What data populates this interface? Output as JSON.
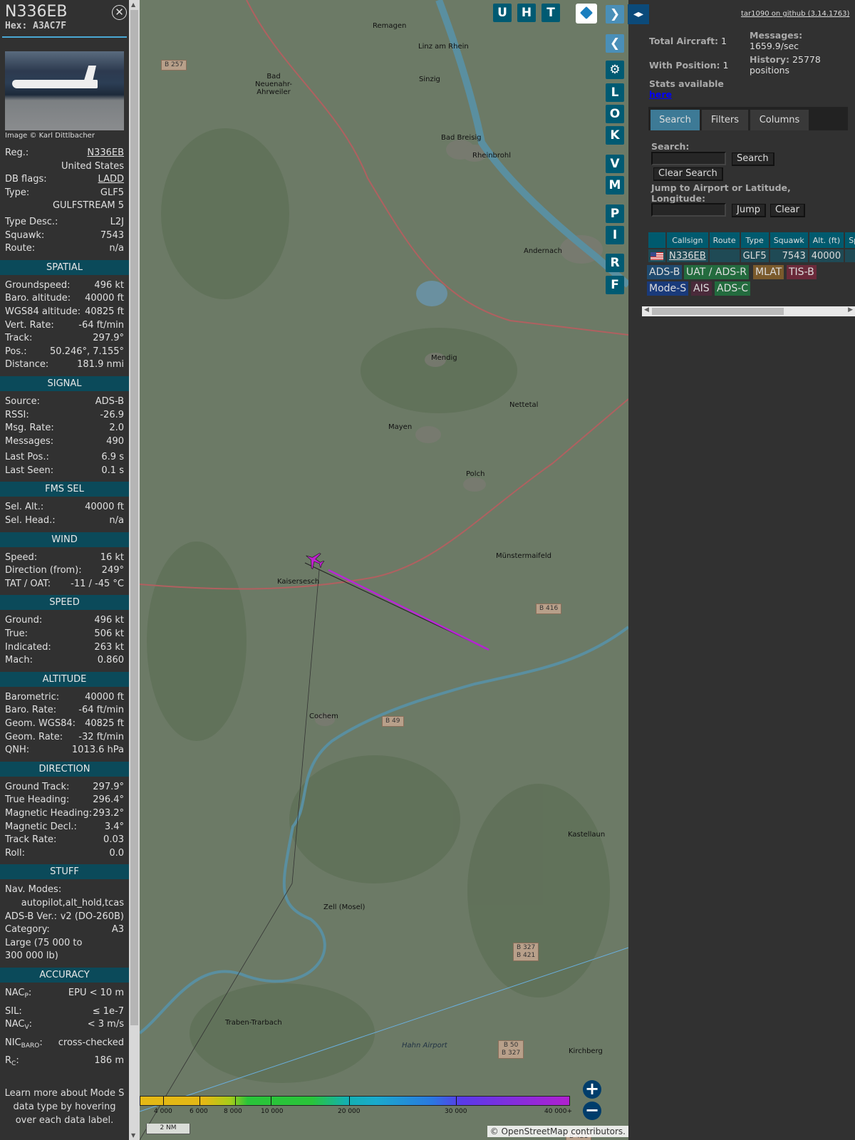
{
  "detail": {
    "reg": "N336EB",
    "hex_label": "Hex:",
    "hex": "A3AC7F",
    "image_credit": "Image © Karl Dittlbacher",
    "rows_top": [
      {
        "k": "Reg.:",
        "v": "N336EB",
        "link": true
      },
      {
        "k": "",
        "v": "United States"
      },
      {
        "k": "DB flags:",
        "v": "LADD",
        "link": true
      },
      {
        "k": "Type:",
        "v": "GLF5"
      },
      {
        "k": "",
        "v": "GULFSTREAM 5"
      },
      {
        "k": "Type Desc.:",
        "v": "L2J"
      },
      {
        "k": "Squawk:",
        "v": "7543"
      },
      {
        "k": "Route:",
        "v": "n/a"
      }
    ],
    "sections": [
      {
        "title": "SPATIAL",
        "rows": [
          {
            "k": "Groundspeed:",
            "v": "496 kt"
          },
          {
            "k": "Baro. altitude:",
            "v": "40000 ft"
          },
          {
            "k": "WGS84 altitude:",
            "v": "40825 ft"
          },
          {
            "k": "Vert. Rate:",
            "v": "-64 ft/min"
          },
          {
            "k": "Track:",
            "v": "297.9°"
          },
          {
            "k": "Pos.:",
            "v": "50.246°, 7.155°"
          },
          {
            "k": "Distance:",
            "v": "181.9 nmi"
          }
        ]
      },
      {
        "title": "SIGNAL",
        "rows": [
          {
            "k": "Source:",
            "v": "ADS-B"
          },
          {
            "k": "RSSI:",
            "v": "-26.9"
          },
          {
            "k": "Msg. Rate:",
            "v": "2.0"
          },
          {
            "k": "Messages:",
            "v": "490"
          },
          {
            "k": "Last Pos.:",
            "v": "6.9 s"
          },
          {
            "k": "Last Seen:",
            "v": "0.1 s"
          }
        ]
      },
      {
        "title": "FMS SEL",
        "rows": [
          {
            "k": "Sel. Alt.:",
            "v": "40000 ft"
          },
          {
            "k": "Sel. Head.:",
            "v": "n/a"
          }
        ]
      },
      {
        "title": "WIND",
        "rows": [
          {
            "k": "Speed:",
            "v": "16 kt"
          },
          {
            "k": "Direction (from):",
            "v": "249°"
          },
          {
            "k": "TAT / OAT:",
            "v": "-11 / -45 °C"
          }
        ]
      },
      {
        "title": "SPEED",
        "rows": [
          {
            "k": "Ground:",
            "v": "496 kt"
          },
          {
            "k": "True:",
            "v": "506 kt"
          },
          {
            "k": "Indicated:",
            "v": "263 kt"
          },
          {
            "k": "Mach:",
            "v": "0.860"
          }
        ]
      },
      {
        "title": "ALTITUDE",
        "rows": [
          {
            "k": "Barometric:",
            "v": "40000 ft"
          },
          {
            "k": "Baro. Rate:",
            "v": "-64 ft/min"
          },
          {
            "k": "Geom. WGS84:",
            "v": "40825 ft"
          },
          {
            "k": "Geom. Rate:",
            "v": "-32 ft/min"
          },
          {
            "k": "QNH:",
            "v": "1013.6 hPa"
          }
        ]
      },
      {
        "title": "DIRECTION",
        "rows": [
          {
            "k": "Ground Track:",
            "v": "297.9°"
          },
          {
            "k": "True Heading:",
            "v": "296.4°"
          },
          {
            "k": "Magnetic Heading:",
            "v": "293.2°"
          },
          {
            "k": "Magnetic Decl.:",
            "v": "3.4°"
          },
          {
            "k": "Track Rate:",
            "v": "0.03"
          },
          {
            "k": "Roll:",
            "v": "0.0"
          }
        ]
      },
      {
        "title": "STUFF",
        "rows": [
          {
            "k": "Nav. Modes:",
            "v": ""
          },
          {
            "k": "",
            "v": "autopilot,alt_hold,tcas"
          },
          {
            "k": "ADS-B Ver.:",
            "v": "v2 (DO-260B)"
          },
          {
            "k": "Category:",
            "v": "A3"
          },
          {
            "k": "Large (75 000 to",
            "v": ""
          },
          {
            "k": "300 000 lb)",
            "v": ""
          }
        ]
      }
    ],
    "accuracy": {
      "title": "ACCURACY",
      "nacp_k": "NAC",
      "nacp_sub": "P",
      "nacp": "EPU < 10 m",
      "sil_k": "SIL:",
      "sil": "≤ 1e-7",
      "nacv_k": "NAC",
      "nacv_sub": "V",
      "nacv": "< 3 m/s",
      "nic_k": "NIC",
      "nic_sub": "BARO",
      "nic": "cross-checked",
      "rc_k": "R",
      "rc_sub": "C",
      "rc": "186 m"
    },
    "note": "Learn more about Mode S data type by hovering over each data label."
  },
  "map": {
    "top_buttons": [
      "U",
      "H",
      "T"
    ],
    "side_buttons": [
      "L",
      "O",
      "K",
      "V",
      "M",
      "P",
      "I",
      "R",
      "F"
    ],
    "towns": [
      "Remagen",
      "Linz am Rhein",
      "Bad Neuenahr-Ahrweiler",
      "Sinzig",
      "Bad Breisig",
      "Rheinbrohl",
      "Andernach",
      "Mendig",
      "Mayen",
      "Polch",
      "Münstermaifeld",
      "Kaisersesch",
      "Cochem",
      "Zell (Mosel)",
      "Kastellaun",
      "Traben-Trarbach",
      "Kirchberg",
      "Hahn Airport",
      "Nettetal"
    ],
    "roads": [
      "B 257",
      "B 416",
      "B 49",
      "B 327\nB 421",
      "B 50\nB 327",
      "B 421"
    ],
    "legend": [
      "4 000",
      "6 000",
      "8 000",
      "10 000",
      "20 000",
      "30 000",
      "40 000+"
    ],
    "scale": "2 NM",
    "attribution_prefix": "©",
    "attribution_link": "OpenStreetMap",
    "attribution_suffix": "contributors."
  },
  "right": {
    "github": "tar1090 on github (3.14.1763)",
    "total_label": "Total Aircraft:",
    "total": "1",
    "withpos_label": "With Position:",
    "withpos": "1",
    "messages_label": "Messages:",
    "messages": "1659.9/sec",
    "history_label": "History:",
    "history": "25778",
    "history_unit": "positions",
    "stats_label": "Stats available",
    "stats_link": "here",
    "tabs": [
      "Search",
      "Filters",
      "Columns"
    ],
    "search_label": "Search:",
    "search_value": "",
    "search_btn": "Search",
    "clear_search_btn": "Clear Search",
    "jump_label": "Jump to Airport or Latitude, Longitude:",
    "jump_value": "",
    "jump_btn": "Jump",
    "clear_btn": "Clear",
    "columns": [
      "Callsign",
      "Route",
      "Type",
      "Squawk",
      "Alt. (ft)",
      "Spd."
    ],
    "rows": [
      {
        "callsign": "N336EB",
        "route": "",
        "type": "GLF5",
        "squawk": "7543",
        "alt": "40000",
        "spd": ""
      }
    ],
    "sources": [
      "ADS-B",
      "UAT / ADS-R",
      "MLAT",
      "TIS-B",
      "Mode-S",
      "AIS",
      "ADS-C"
    ],
    "source_colors": [
      "#1f4a6e",
      "#236b3e",
      "#7a5a2c",
      "#6b2a3a",
      "#1a3a7a",
      "#4a2a3a",
      "#236b3e"
    ]
  }
}
